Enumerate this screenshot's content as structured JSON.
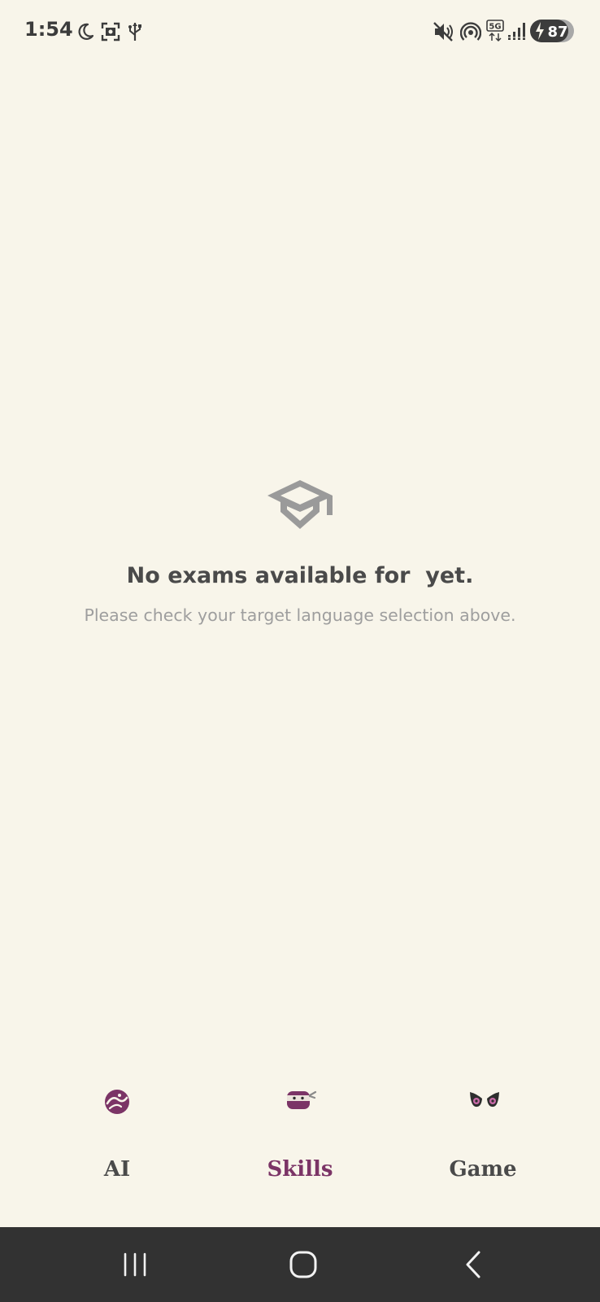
{
  "status_bar": {
    "time": "1:54",
    "left_icons": [
      "moon-icon",
      "screenshot-icon",
      "usb-icon"
    ],
    "right_icons": [
      "mute-icon",
      "hotspot-icon",
      "5g-icon",
      "signal-icon",
      "battery-icon"
    ],
    "network": "5G",
    "battery": "87"
  },
  "empty_state": {
    "icon": "graduation-cap-icon",
    "title": "No exams available for  yet.",
    "subtitle": "Please check your target language selection above."
  },
  "bottom_nav": {
    "items": [
      {
        "label": "AI",
        "icon": "ai-swirl-icon",
        "active": false
      },
      {
        "label": "Skills",
        "icon": "ninja-icon",
        "active": true
      },
      {
        "label": "Game",
        "icon": "eyes-icon",
        "active": false
      }
    ]
  },
  "system_nav": {
    "buttons": [
      "recents-icon",
      "home-icon",
      "back-icon"
    ]
  },
  "colors": {
    "background": "#f8f5ea",
    "accent": "#7b3466",
    "text": "#4a4a4a",
    "muted": "#9e9e9e",
    "system_bar": "#323232"
  }
}
